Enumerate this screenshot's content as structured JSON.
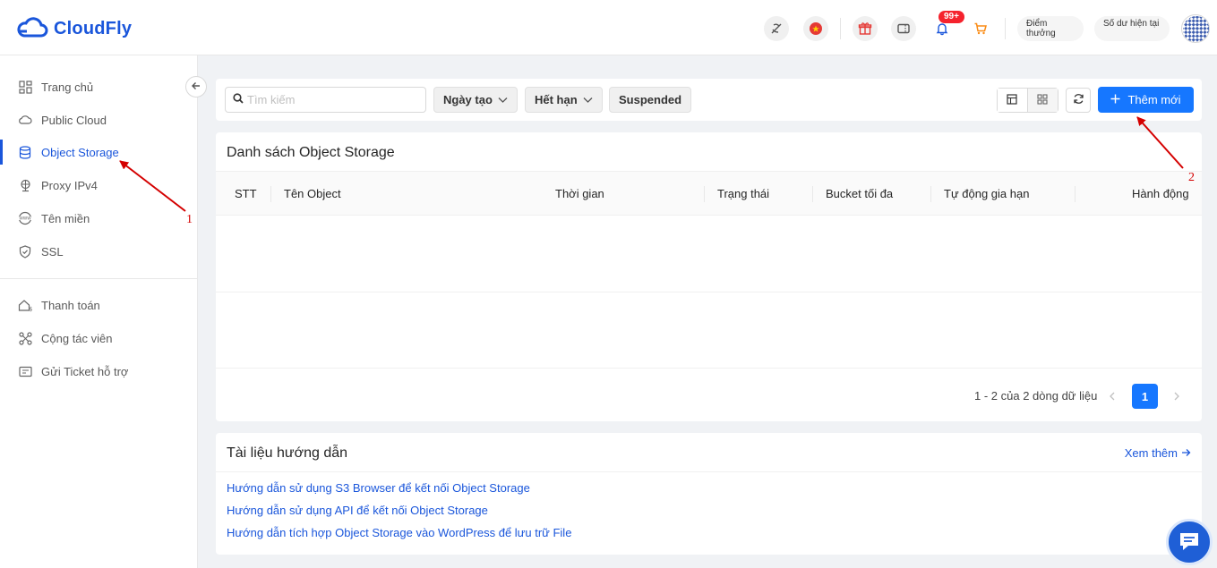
{
  "header": {
    "logo_text": "CloudFly",
    "notification_badge": "99+",
    "points_label": "Điểm thưởng",
    "balance_label": "Số dư hiện tại"
  },
  "sidebar": {
    "items": [
      {
        "label": "Trang chủ",
        "icon": "grid-icon"
      },
      {
        "label": "Public Cloud",
        "icon": "cloud-icon"
      },
      {
        "label": "Object Storage",
        "icon": "database-icon",
        "active": true
      },
      {
        "label": "Proxy IPv4",
        "icon": "globe-pin-icon"
      },
      {
        "label": "Tên miền",
        "icon": "www-icon"
      },
      {
        "label": "SSL",
        "icon": "shield-icon"
      }
    ],
    "items2": [
      {
        "label": "Thanh toán",
        "icon": "payment-icon"
      },
      {
        "label": "Cộng tác viên",
        "icon": "network-icon"
      },
      {
        "label": "Gửi Ticket hỗ trợ",
        "icon": "ticket-icon"
      }
    ]
  },
  "toolbar": {
    "search_placeholder": "Tìm kiếm",
    "filter_created": "Ngày tạo",
    "filter_expire": "Hết hạn",
    "filter_suspended": "Suspended",
    "add_label": "Thêm mới"
  },
  "table": {
    "title": "Danh sách Object Storage",
    "columns": [
      "STT",
      "Tên Object",
      "Thời gian",
      "Trạng thái",
      "Bucket tối đa",
      "Tự động gia hạn",
      "Hành động"
    ],
    "pagination_text": "1 - 2 của 2 dòng dữ liệu",
    "current_page": "1"
  },
  "docs": {
    "title": "Tài liệu hướng dẫn",
    "more_label": "Xem thêm",
    "links": [
      "Hướng dẫn sử dụng S3 Browser để kết nối Object Storage",
      "Hướng dẫn sử dụng API để kết nối Object Storage",
      "Hướng dẫn tích hợp Object Storage vào WordPress để lưu trữ File"
    ]
  },
  "annotations": [
    "1",
    "2"
  ],
  "colors": {
    "brand": "#1a56db",
    "primary_button": "#1677ff",
    "annotation": "#d40000"
  }
}
